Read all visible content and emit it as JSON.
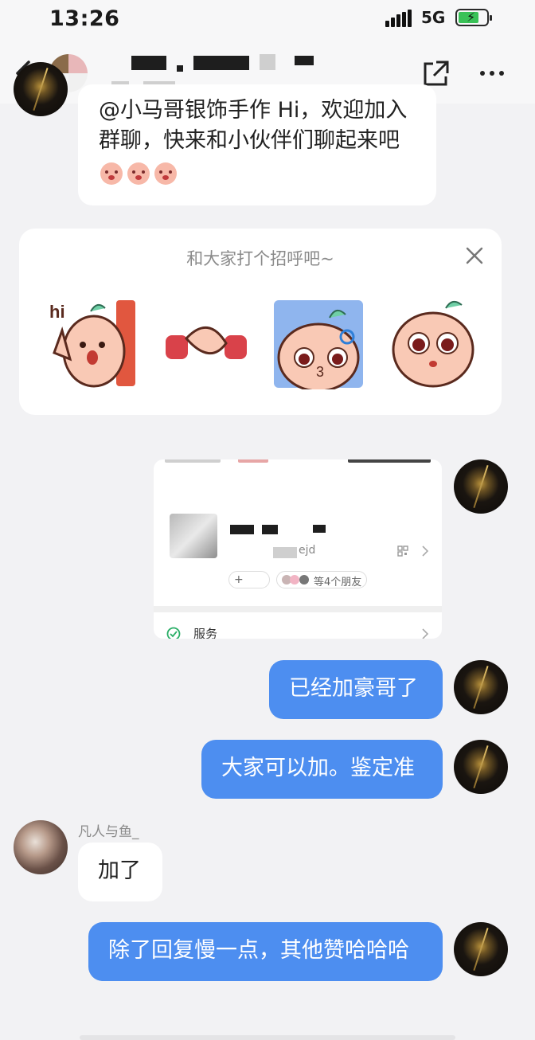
{
  "status": {
    "time": "13:26",
    "network": "5G"
  },
  "chat": {
    "welcome_message": "@小马哥银饰手作 Hi，欢迎加入群聊，快来和小伙伴们聊起来吧",
    "greeting_card_title": "和大家打个招呼吧~",
    "sticker_hi_text": "hi",
    "screenshot": {
      "handle_suffix": "ejd",
      "friends_text": "等4个朋友",
      "service_label": "服务"
    },
    "messages": [
      {
        "text": "已经加豪哥了"
      },
      {
        "text": "大家可以加。鉴定准"
      },
      {
        "sender": "凡人与鱼_",
        "text": "加了"
      },
      {
        "text": "除了回复慢一点，其他赞哈哈哈"
      }
    ]
  },
  "icons": [
    "back-icon",
    "share-icon",
    "more-icon",
    "close-icon",
    "qr-code-icon",
    "chevron-right-icon",
    "wechat-pay-icon"
  ],
  "colors": {
    "self_bubble": "#4d8ef0",
    "other_bubble": "#ffffff",
    "background": "#f2f2f4"
  }
}
